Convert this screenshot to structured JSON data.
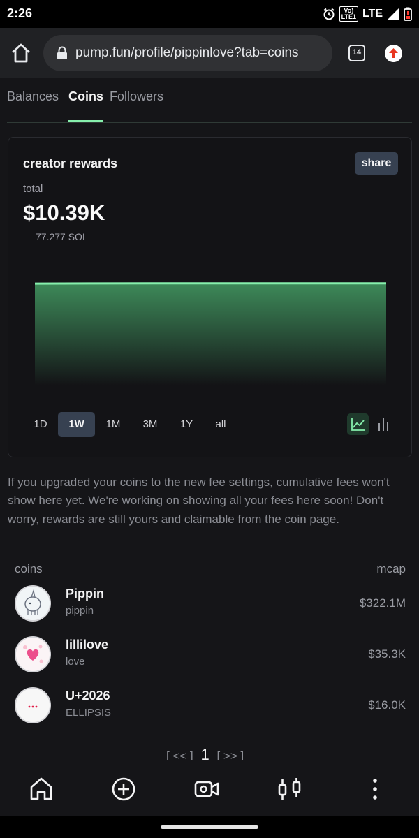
{
  "status_bar": {
    "time": "2:26",
    "volte_top": "Vo)",
    "volte_bottom": "LTE1",
    "network": "LTE"
  },
  "browser": {
    "url": "pump.fun/profile/pippinlove?tab=coins",
    "tab_count": "14"
  },
  "tabs": [
    {
      "label": "Balances",
      "active": false
    },
    {
      "label": "Coins",
      "active": true
    },
    {
      "label": "Followers",
      "active": false
    }
  ],
  "rewards": {
    "title": "creator rewards",
    "share_label": "share",
    "total_label": "total",
    "total_value": "$10.39K",
    "sol_value": "77.277 SOL",
    "ranges": [
      "1D",
      "1W",
      "1M",
      "3M",
      "1Y",
      "all"
    ],
    "active_range": "1W",
    "accent_color": "#86efac"
  },
  "chart_data": {
    "type": "area",
    "x": [
      0,
      1,
      2,
      3,
      4,
      5,
      6
    ],
    "y": [
      10.36,
      10.37,
      10.38,
      10.38,
      10.39,
      10.39,
      10.39
    ],
    "title": "",
    "xlabel": "",
    "ylabel": "",
    "grid": false,
    "legend": "none"
  },
  "notice": "If you upgraded your coins to the new fee settings, cumulative fees won't show here yet. We're working on showing all your fees here soon! Don't worry, rewards are still yours and claimable from the coin page.",
  "coins_list": {
    "header_left": "coins",
    "header_right": "mcap",
    "items": [
      {
        "name": "Pippin",
        "ticker": "pippin",
        "mcap": "$322.1M",
        "icon": "pippin-unicorn-icon"
      },
      {
        "name": "lillilove",
        "ticker": "love",
        "mcap": "$35.3K",
        "icon": "heart-icon"
      },
      {
        "name": "U+2026",
        "ticker": "ELLIPSIS",
        "mcap": "$16.0K",
        "icon": "ellipsis-icon"
      }
    ]
  },
  "pagination": {
    "prev": "[ << ]",
    "current": "1",
    "next": "[ >> ]"
  },
  "bottom_nav": [
    "home-icon",
    "create-coin-icon",
    "livestream-icon",
    "trade-chart-icon",
    "more-icon"
  ]
}
